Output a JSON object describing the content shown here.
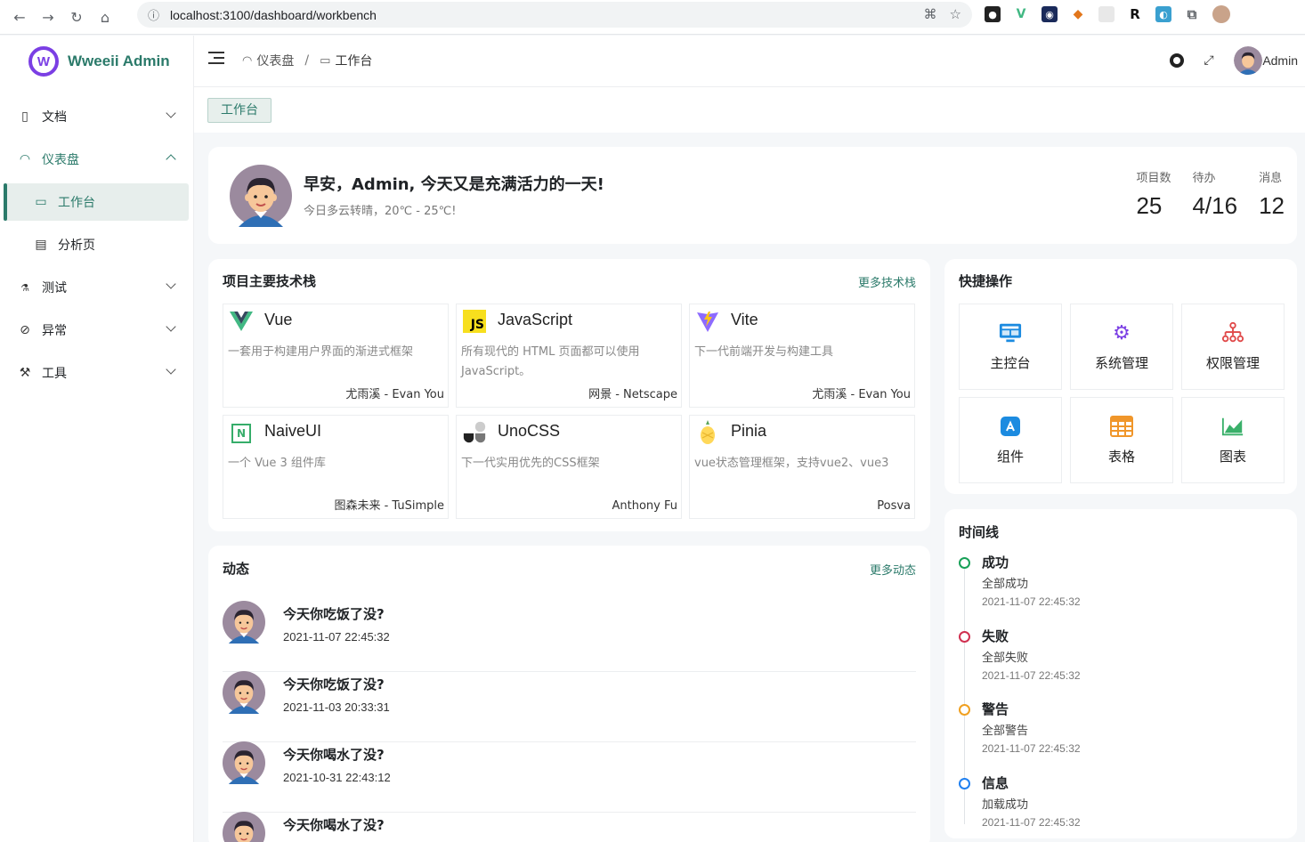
{
  "browser": {
    "url": "localhost:3100/dashboard/workbench"
  },
  "sidebar": {
    "logo_text": "Wweeii Admin",
    "items": [
      {
        "label": "文档",
        "icon": "document-icon"
      },
      {
        "label": "仪表盘",
        "icon": "dashboard-icon"
      },
      {
        "label": "工作台",
        "icon": "monitor-icon"
      },
      {
        "label": "分析页",
        "icon": "chart-icon"
      },
      {
        "label": "测试",
        "icon": "js-test-icon"
      },
      {
        "label": "异常",
        "icon": "ban-icon"
      },
      {
        "label": "工具",
        "icon": "tool-icon"
      }
    ]
  },
  "header": {
    "breadcrumb": [
      "仪表盘",
      "工作台"
    ],
    "username": "Admin"
  },
  "tabs": [
    "工作台"
  ],
  "welcome": {
    "greeting": "早安，Admin, 今天又是充满活力的一天!",
    "weather": "今日多云转晴，20℃ - 25℃!",
    "stats": [
      {
        "label": "项目数",
        "value": "25"
      },
      {
        "label": "待办",
        "value": "4/16"
      },
      {
        "label": "消息",
        "value": "12"
      }
    ]
  },
  "tech": {
    "title": "项目主要技术栈",
    "more": "更多技术栈",
    "items": [
      {
        "name": "Vue",
        "desc": "一套用于构建用户界面的渐进式框架",
        "author": "尤雨溪 - Evan You",
        "icon": "vue-logo-icon"
      },
      {
        "name": "JavaScript",
        "desc": "所有现代的 HTML 页面都可以使用 JavaScript。",
        "author": "网景 - Netscape",
        "icon": "js-logo-icon"
      },
      {
        "name": "Vite",
        "desc": "下一代前端开发与构建工具",
        "author": "尤雨溪 - Evan You",
        "icon": "vite-logo-icon"
      },
      {
        "name": "NaiveUI",
        "desc": "一个 Vue 3 组件库",
        "author": "图森未来 - TuSimple",
        "icon": "naiveui-logo-icon"
      },
      {
        "name": "UnoCSS",
        "desc": "下一代实用优先的CSS框架",
        "author": "Anthony Fu",
        "icon": "unocss-logo-icon"
      },
      {
        "name": "Pinia",
        "desc": "vue状态管理框架，支持vue2、vue3",
        "author": "Posva",
        "icon": "pinia-logo-icon"
      }
    ]
  },
  "quick": {
    "title": "快捷操作",
    "items": [
      {
        "label": "主控台",
        "icon": "monitor-icon",
        "color": "#1c8be0"
      },
      {
        "label": "系统管理",
        "icon": "gear-icon",
        "color": "#7b3fe4"
      },
      {
        "label": "权限管理",
        "icon": "org-chart-icon",
        "color": "#e04848"
      },
      {
        "label": "组件",
        "icon": "app-store-icon",
        "color": "#1c8be0"
      },
      {
        "label": "表格",
        "icon": "table-icon",
        "color": "#f0962a"
      },
      {
        "label": "图表",
        "icon": "area-chart-icon",
        "color": "#3ab06a"
      }
    ]
  },
  "feed": {
    "title": "动态",
    "more": "更多动态",
    "items": [
      {
        "title": "今天你吃饭了没?",
        "date": "2021-11-07 22:45:32"
      },
      {
        "title": "今天你吃饭了没?",
        "date": "2021-11-03 20:33:31"
      },
      {
        "title": "今天你喝水了没?",
        "date": "2021-10-31 22:43:12"
      },
      {
        "title": "今天你喝水了没?",
        "date": ""
      }
    ]
  },
  "timeline": {
    "title": "时间线",
    "items": [
      {
        "title": "成功",
        "content": "全部成功",
        "time": "2021-11-07 22:45:32",
        "color": "#18a058"
      },
      {
        "title": "失败",
        "content": "全部失败",
        "time": "2021-11-07 22:45:32",
        "color": "#d03050"
      },
      {
        "title": "警告",
        "content": "全部警告",
        "time": "2021-11-07 22:45:32",
        "color": "#f0a020"
      },
      {
        "title": "信息",
        "content": "加载成功",
        "time": "2021-11-07 22:45:32",
        "color": "#2080f0"
      }
    ]
  }
}
